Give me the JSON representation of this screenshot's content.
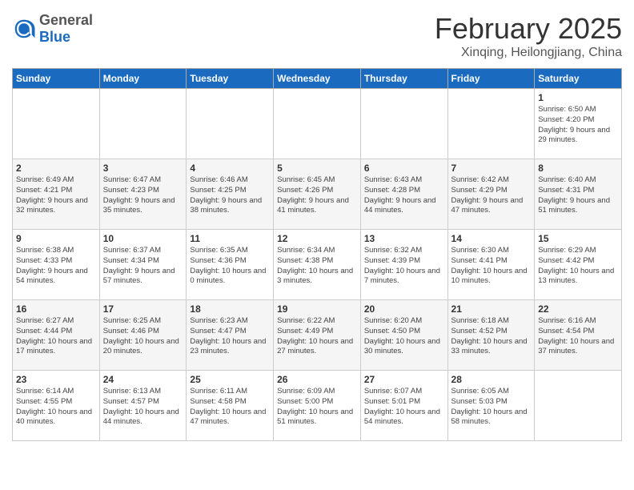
{
  "header": {
    "logo": {
      "general": "General",
      "blue": "Blue"
    },
    "title": "February 2025",
    "subtitle": "Xinqing, Heilongjiang, China"
  },
  "days_of_week": [
    "Sunday",
    "Monday",
    "Tuesday",
    "Wednesday",
    "Thursday",
    "Friday",
    "Saturday"
  ],
  "weeks": [
    [
      {
        "day": "",
        "info": ""
      },
      {
        "day": "",
        "info": ""
      },
      {
        "day": "",
        "info": ""
      },
      {
        "day": "",
        "info": ""
      },
      {
        "day": "",
        "info": ""
      },
      {
        "day": "",
        "info": ""
      },
      {
        "day": "1",
        "info": "Sunrise: 6:50 AM\nSunset: 4:20 PM\nDaylight: 9 hours and 29 minutes."
      }
    ],
    [
      {
        "day": "2",
        "info": "Sunrise: 6:49 AM\nSunset: 4:21 PM\nDaylight: 9 hours and 32 minutes."
      },
      {
        "day": "3",
        "info": "Sunrise: 6:47 AM\nSunset: 4:23 PM\nDaylight: 9 hours and 35 minutes."
      },
      {
        "day": "4",
        "info": "Sunrise: 6:46 AM\nSunset: 4:25 PM\nDaylight: 9 hours and 38 minutes."
      },
      {
        "day": "5",
        "info": "Sunrise: 6:45 AM\nSunset: 4:26 PM\nDaylight: 9 hours and 41 minutes."
      },
      {
        "day": "6",
        "info": "Sunrise: 6:43 AM\nSunset: 4:28 PM\nDaylight: 9 hours and 44 minutes."
      },
      {
        "day": "7",
        "info": "Sunrise: 6:42 AM\nSunset: 4:29 PM\nDaylight: 9 hours and 47 minutes."
      },
      {
        "day": "8",
        "info": "Sunrise: 6:40 AM\nSunset: 4:31 PM\nDaylight: 9 hours and 51 minutes."
      }
    ],
    [
      {
        "day": "9",
        "info": "Sunrise: 6:38 AM\nSunset: 4:33 PM\nDaylight: 9 hours and 54 minutes."
      },
      {
        "day": "10",
        "info": "Sunrise: 6:37 AM\nSunset: 4:34 PM\nDaylight: 9 hours and 57 minutes."
      },
      {
        "day": "11",
        "info": "Sunrise: 6:35 AM\nSunset: 4:36 PM\nDaylight: 10 hours and 0 minutes."
      },
      {
        "day": "12",
        "info": "Sunrise: 6:34 AM\nSunset: 4:38 PM\nDaylight: 10 hours and 3 minutes."
      },
      {
        "day": "13",
        "info": "Sunrise: 6:32 AM\nSunset: 4:39 PM\nDaylight: 10 hours and 7 minutes."
      },
      {
        "day": "14",
        "info": "Sunrise: 6:30 AM\nSunset: 4:41 PM\nDaylight: 10 hours and 10 minutes."
      },
      {
        "day": "15",
        "info": "Sunrise: 6:29 AM\nSunset: 4:42 PM\nDaylight: 10 hours and 13 minutes."
      }
    ],
    [
      {
        "day": "16",
        "info": "Sunrise: 6:27 AM\nSunset: 4:44 PM\nDaylight: 10 hours and 17 minutes."
      },
      {
        "day": "17",
        "info": "Sunrise: 6:25 AM\nSunset: 4:46 PM\nDaylight: 10 hours and 20 minutes."
      },
      {
        "day": "18",
        "info": "Sunrise: 6:23 AM\nSunset: 4:47 PM\nDaylight: 10 hours and 23 minutes."
      },
      {
        "day": "19",
        "info": "Sunrise: 6:22 AM\nSunset: 4:49 PM\nDaylight: 10 hours and 27 minutes."
      },
      {
        "day": "20",
        "info": "Sunrise: 6:20 AM\nSunset: 4:50 PM\nDaylight: 10 hours and 30 minutes."
      },
      {
        "day": "21",
        "info": "Sunrise: 6:18 AM\nSunset: 4:52 PM\nDaylight: 10 hours and 33 minutes."
      },
      {
        "day": "22",
        "info": "Sunrise: 6:16 AM\nSunset: 4:54 PM\nDaylight: 10 hours and 37 minutes."
      }
    ],
    [
      {
        "day": "23",
        "info": "Sunrise: 6:14 AM\nSunset: 4:55 PM\nDaylight: 10 hours and 40 minutes."
      },
      {
        "day": "24",
        "info": "Sunrise: 6:13 AM\nSunset: 4:57 PM\nDaylight: 10 hours and 44 minutes."
      },
      {
        "day": "25",
        "info": "Sunrise: 6:11 AM\nSunset: 4:58 PM\nDaylight: 10 hours and 47 minutes."
      },
      {
        "day": "26",
        "info": "Sunrise: 6:09 AM\nSunset: 5:00 PM\nDaylight: 10 hours and 51 minutes."
      },
      {
        "day": "27",
        "info": "Sunrise: 6:07 AM\nSunset: 5:01 PM\nDaylight: 10 hours and 54 minutes."
      },
      {
        "day": "28",
        "info": "Sunrise: 6:05 AM\nSunset: 5:03 PM\nDaylight: 10 hours and 58 minutes."
      },
      {
        "day": "",
        "info": ""
      }
    ]
  ]
}
